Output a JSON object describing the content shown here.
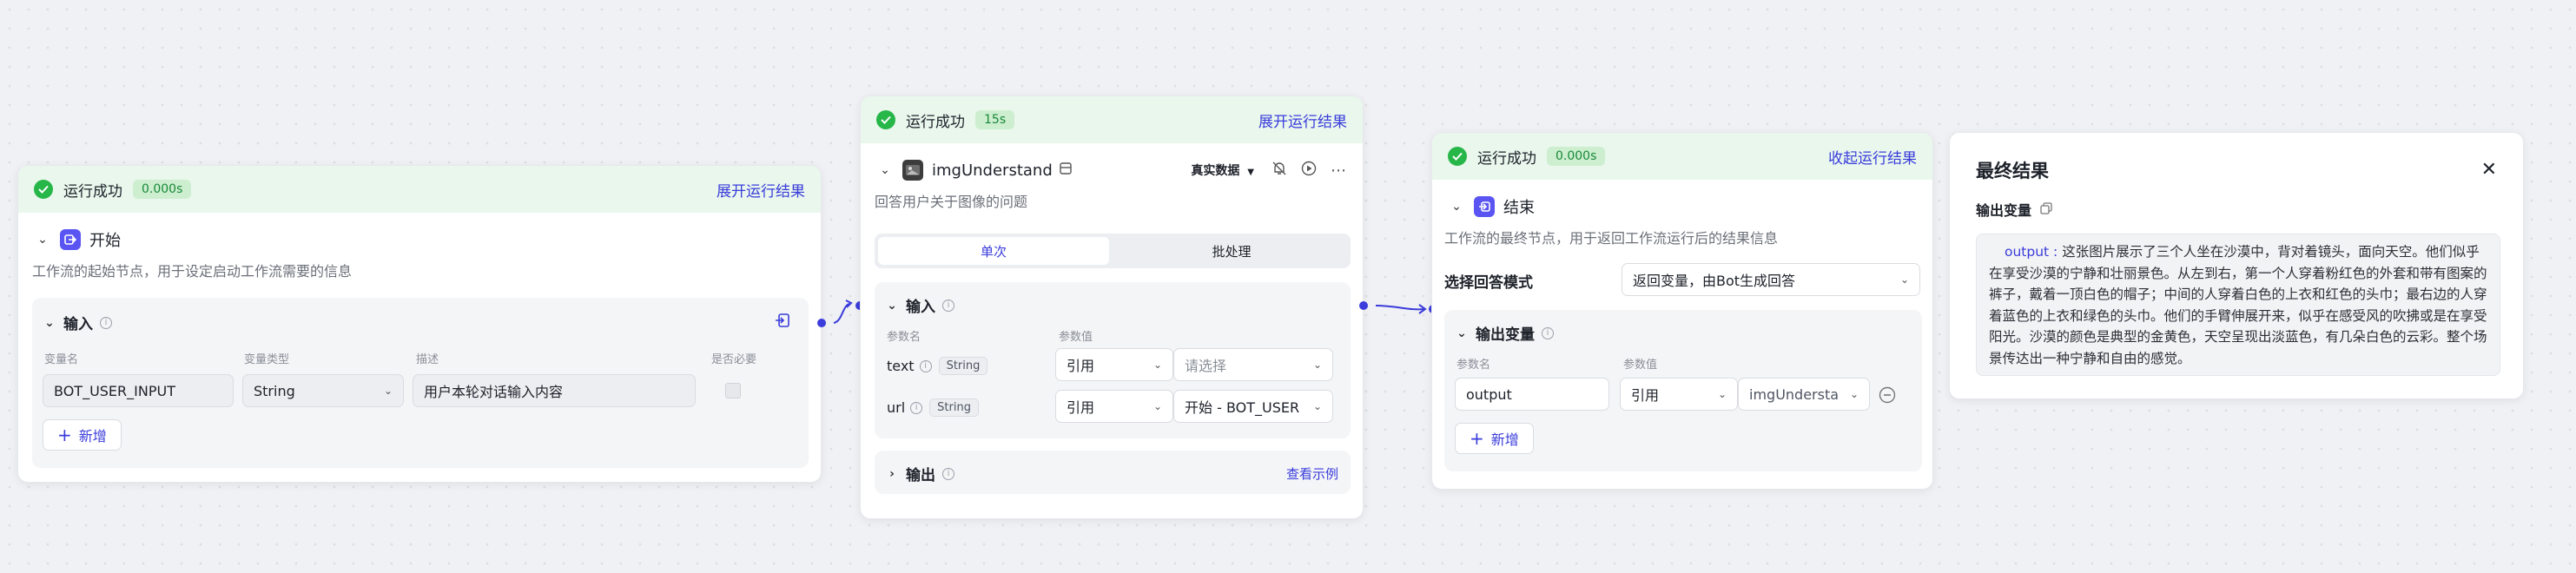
{
  "colors": {
    "accent": "#3a3cdb",
    "success": "#27b648",
    "node_icon": "#5a55f2"
  },
  "start_node": {
    "status": "运行成功",
    "time": "0.000s",
    "expand_label": "展开运行结果",
    "title": "开始",
    "description": "工作流的起始节点，用于设定启动工作流需要的信息",
    "input_section_title": "输入",
    "columns": [
      "变量名",
      "变量类型",
      "描述",
      "是否必要"
    ],
    "row": {
      "name": "BOT_USER_INPUT",
      "type": "String",
      "description": "用户本轮对话输入内容"
    },
    "add_label": "新增"
  },
  "img_node": {
    "status": "运行成功",
    "time": "15s",
    "expand_label": "展开运行结果",
    "title": "imgUnderstand",
    "data_mode": "真实数据",
    "description": "回答用户关于图像的问题",
    "tabs": [
      "单次",
      "批处理"
    ],
    "input_section_title": "输入",
    "columns": [
      "参数名",
      "参数值"
    ],
    "params": [
      {
        "name": "text",
        "type": "String",
        "mode": "引用",
        "value": "请选择"
      },
      {
        "name": "url",
        "type": "String",
        "mode": "引用",
        "value": "开始 - BOT_USER"
      }
    ],
    "output_section_title": "输出",
    "example_link": "查看示例"
  },
  "end_node": {
    "status": "运行成功",
    "time": "0.000s",
    "collapse_label": "收起运行结果",
    "title": "结束",
    "description": "工作流的最终节点，用于返回工作流运行后的结果信息",
    "answer_mode_label": "选择回答模式",
    "answer_mode_value": "返回变量，由Bot生成回答",
    "output_section_title": "输出变量",
    "columns": [
      "参数名",
      "参数值"
    ],
    "row": {
      "name": "output",
      "mode": "引用",
      "value": "imgUndersta"
    },
    "add_label": "新增"
  },
  "result_panel": {
    "title": "最终结果",
    "close_icon": "close-icon",
    "output_label": "输出变量",
    "output_key": "output",
    "output_text": "这张图片展示了三个人坐在沙漠中，背对着镜头，面向天空。他们似乎在享受沙漠的宁静和壮丽景色。从左到右，第一个人穿着粉红色的外套和带有图案的裤子，戴着一顶白色的帽子；中间的人穿着白色的上衣和红色的头巾；最右边的人穿着蓝色的上衣和绿色的头巾。他们的手臂伸展开来，似乎在感受风的吹拂或是在享受阳光。沙漠的颜色是典型的金黄色，天空呈现出淡蓝色，有几朵白色的云彩。整个场景传达出一种宁静和自由的感觉。"
  }
}
